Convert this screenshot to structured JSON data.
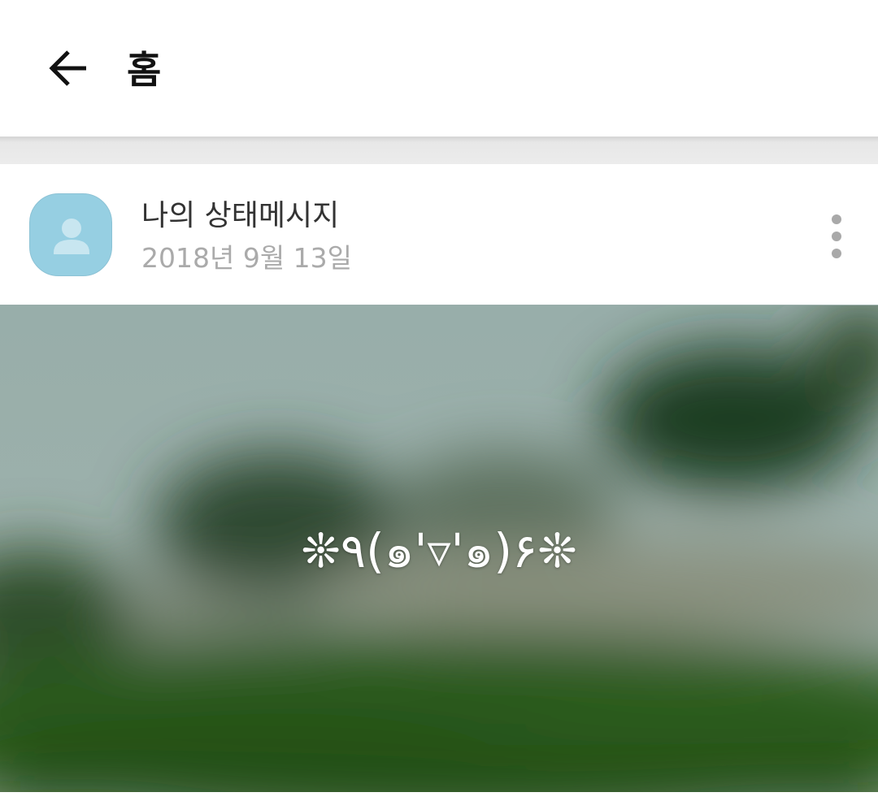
{
  "app_bar": {
    "title": "홈",
    "back_icon": "arrow-left-icon"
  },
  "post": {
    "author_name": "나의 상태메시지",
    "date": "2018년 9월 13일",
    "avatar_icon": "person-icon",
    "more_icon": "more-vertical-icon",
    "status_message": "❊٩(๑'▿'๑)۶❊"
  },
  "colors": {
    "avatar_bg": "#96cfe2",
    "title_text": "#111111",
    "date_text": "#aaaaaa"
  }
}
